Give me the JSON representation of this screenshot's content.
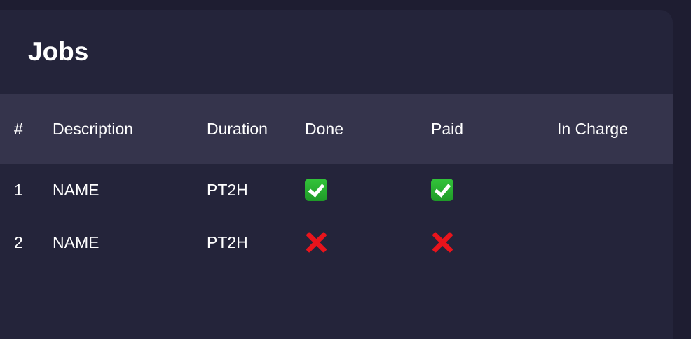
{
  "page": {
    "title": "Jobs"
  },
  "table": {
    "headers": {
      "num": "#",
      "description": "Description",
      "duration": "Duration",
      "done": "Done",
      "paid": "Paid",
      "in_charge": "In Charge"
    },
    "rows": [
      {
        "num": "1",
        "description": "NAME",
        "duration": "PT2H",
        "done": "check-mark-icon",
        "paid": "check-mark-icon",
        "in_charge": ""
      },
      {
        "num": "2",
        "description": "NAME",
        "duration": "PT2H",
        "done": "cross-mark-icon",
        "paid": "cross-mark-icon",
        "in_charge": ""
      }
    ]
  },
  "colors": {
    "background": "#1e1d31",
    "card": "#24243a",
    "header_row": "#35344c",
    "check_green": "#2bb233",
    "cross_red": "#e8141c"
  }
}
